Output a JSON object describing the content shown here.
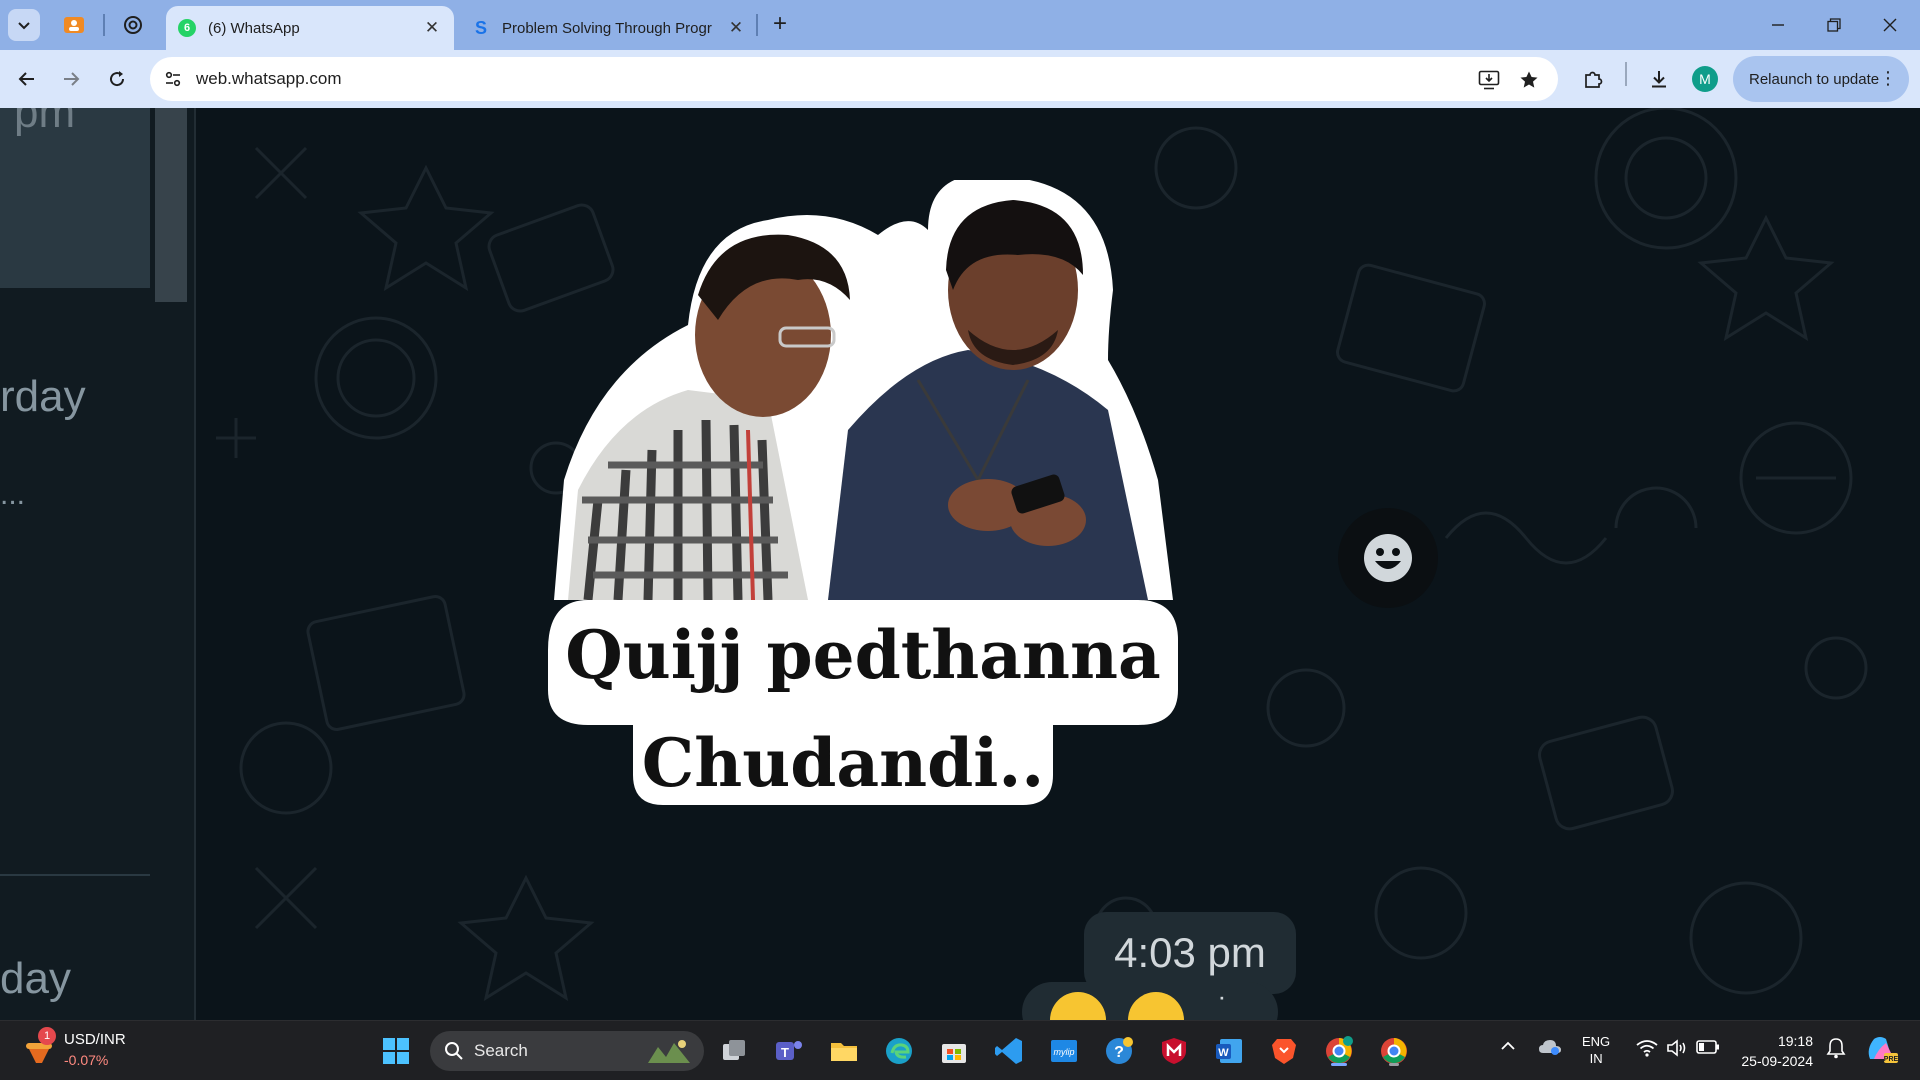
{
  "browser": {
    "tabs": [
      {
        "title": "(6) WhatsApp",
        "badge": "6",
        "active": true
      },
      {
        "title": "Problem Solving Through Progr",
        "active": false
      }
    ],
    "address": "web.whatsapp.com",
    "relaunch_label": "Relaunch to update",
    "profile_initial": "M"
  },
  "sidebar": {
    "fragment_top": "pm",
    "fragment_mid": "rday",
    "fragment_dots": "...",
    "fragment_bottom": "day"
  },
  "chat": {
    "sticker_caption_line1": "Quijj pedthanna",
    "sticker_caption_line2": "Chudandi..",
    "timestamp": "4:03 pm"
  },
  "taskbar": {
    "widget_notification": "1",
    "widget_title": "USD/INR",
    "widget_change": "-0.07%",
    "search_label": "Search",
    "lang_line1": "ENG",
    "lang_line2": "IN",
    "time": "19:18",
    "date": "25-09-2024"
  },
  "colors": {
    "chat_bg": "#0b141a",
    "tabstrip": "#8fb0e6",
    "toolbar": "#d9e6fb",
    "bubble": "#202c33",
    "whatsapp_green": "#25d366"
  }
}
